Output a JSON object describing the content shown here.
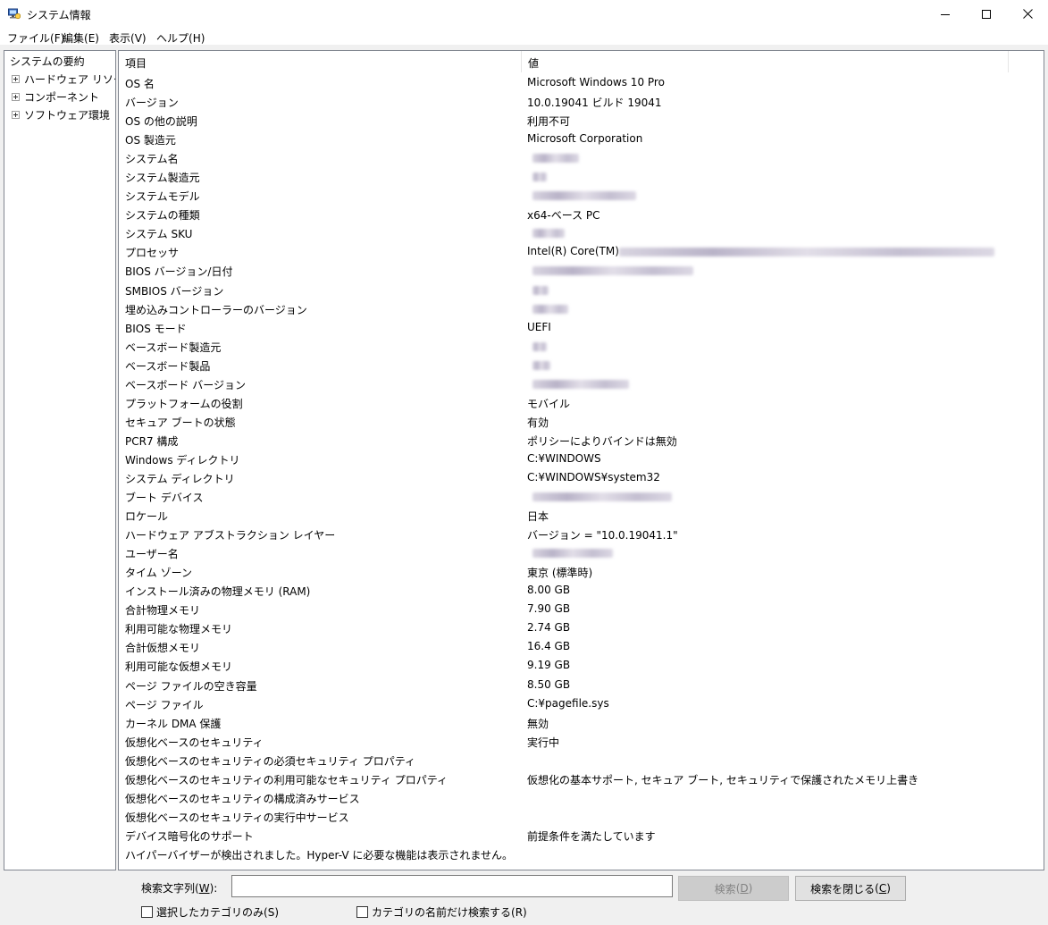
{
  "window": {
    "title": "システム情報",
    "icon": "system-information-icon",
    "controls": [
      "minimize-icon",
      "maximize-icon",
      "close-icon"
    ]
  },
  "menu": [
    {
      "label": "ファイル",
      "key": "(F)"
    },
    {
      "label": "編集",
      "key": "(E)"
    },
    {
      "label": "表示",
      "key": "(V)"
    },
    {
      "label": "ヘルプ",
      "key": "(H)"
    }
  ],
  "tree": {
    "root": "システムの要約",
    "children": [
      "ハードウェア リソース",
      "コンポーネント",
      "ソフトウェア環境"
    ]
  },
  "list": {
    "columns": [
      "項目",
      "値"
    ],
    "rows": [
      {
        "item": "OS 名",
        "value": "Microsoft Windows 10 Pro"
      },
      {
        "item": "バージョン",
        "value": "10.0.19041 ビルド 19041"
      },
      {
        "item": "OS の他の説明",
        "value": "利用不可"
      },
      {
        "item": "OS 製造元",
        "value": "Microsoft Corporation"
      },
      {
        "item": "システム名",
        "value": ""
      },
      {
        "item": "システム製造元",
        "value": ""
      },
      {
        "item": "システムモデル",
        "value": ""
      },
      {
        "item": "システムの種類",
        "value": "x64-ベース PC"
      },
      {
        "item": "システム SKU",
        "value": ""
      },
      {
        "item": "プロセッサ",
        "value": "Intel(R) Core(TM)"
      },
      {
        "item": "BIOS バージョン/日付",
        "value": ""
      },
      {
        "item": "SMBIOS バージョン",
        "value": ""
      },
      {
        "item": "埋め込みコントローラーのバージョン",
        "value": ""
      },
      {
        "item": "BIOS モード",
        "value": "UEFI"
      },
      {
        "item": "ベースボード製造元",
        "value": ""
      },
      {
        "item": "ベースボード製品",
        "value": ""
      },
      {
        "item": "ベースボード バージョン",
        "value": ""
      },
      {
        "item": "プラットフォームの役割",
        "value": "モバイル"
      },
      {
        "item": "セキュア ブートの状態",
        "value": "有効"
      },
      {
        "item": "PCR7 構成",
        "value": "ポリシーによりバインドは無効"
      },
      {
        "item": "Windows ディレクトリ",
        "value": "C:¥WINDOWS"
      },
      {
        "item": "システム ディレクトリ",
        "value": "C:¥WINDOWS¥system32"
      },
      {
        "item": "ブート デバイス",
        "value": ""
      },
      {
        "item": "ロケール",
        "value": "日本"
      },
      {
        "item": "ハードウェア アブストラクション レイヤー",
        "value": "バージョン = \"10.0.19041.1\""
      },
      {
        "item": "ユーザー名",
        "value": ""
      },
      {
        "item": "タイム ゾーン",
        "value": "東京 (標準時)"
      },
      {
        "item": "インストール済みの物理メモリ (RAM)",
        "value": "8.00 GB"
      },
      {
        "item": "合計物理メモリ",
        "value": "7.90 GB"
      },
      {
        "item": "利用可能な物理メモリ",
        "value": "2.74 GB"
      },
      {
        "item": "合計仮想メモリ",
        "value": "16.4 GB"
      },
      {
        "item": "利用可能な仮想メモリ",
        "value": "9.19 GB"
      },
      {
        "item": "ページ ファイルの空き容量",
        "value": "8.50 GB"
      },
      {
        "item": "ページ ファイル",
        "value": "C:¥pagefile.sys"
      },
      {
        "item": "カーネル DMA 保護",
        "value": "無効"
      },
      {
        "item": "仮想化ベースのセキュリティ",
        "value": "実行中"
      },
      {
        "item": "仮想化ベースのセキュリティの必須セキュリティ プロパティ",
        "value": ""
      },
      {
        "item": "仮想化ベースのセキュリティの利用可能なセキュリティ プロパティ",
        "value": "仮想化の基本サポート, セキュア ブート, セキュリティで保護されたメモリ上書き"
      },
      {
        "item": "仮想化ベースのセキュリティの構成済みサービス",
        "value": ""
      },
      {
        "item": "仮想化ベースのセキュリティの実行中サービス",
        "value": ""
      },
      {
        "item": "デバイス暗号化のサポート",
        "value": "前提条件を満たしています"
      },
      {
        "item": "ハイパーバイザーが検出されました。Hyper-V に必要な機能は表示されません。",
        "value": ""
      }
    ]
  },
  "search": {
    "label": "検索文字列",
    "label_key": "W",
    "input_value": "",
    "find_button": "検索",
    "find_key": "D",
    "close_button": "検索を閉じる",
    "close_key": "C",
    "checkbox_selected_category": "選択したカテゴリのみ",
    "checkbox_selected_category_key": "(S)",
    "checkbox_category_names": "カテゴリの名前だけ検索する",
    "checkbox_category_names_key": "(R)",
    "checkbox_selected_category_checked": false,
    "checkbox_category_names_checked": false
  }
}
